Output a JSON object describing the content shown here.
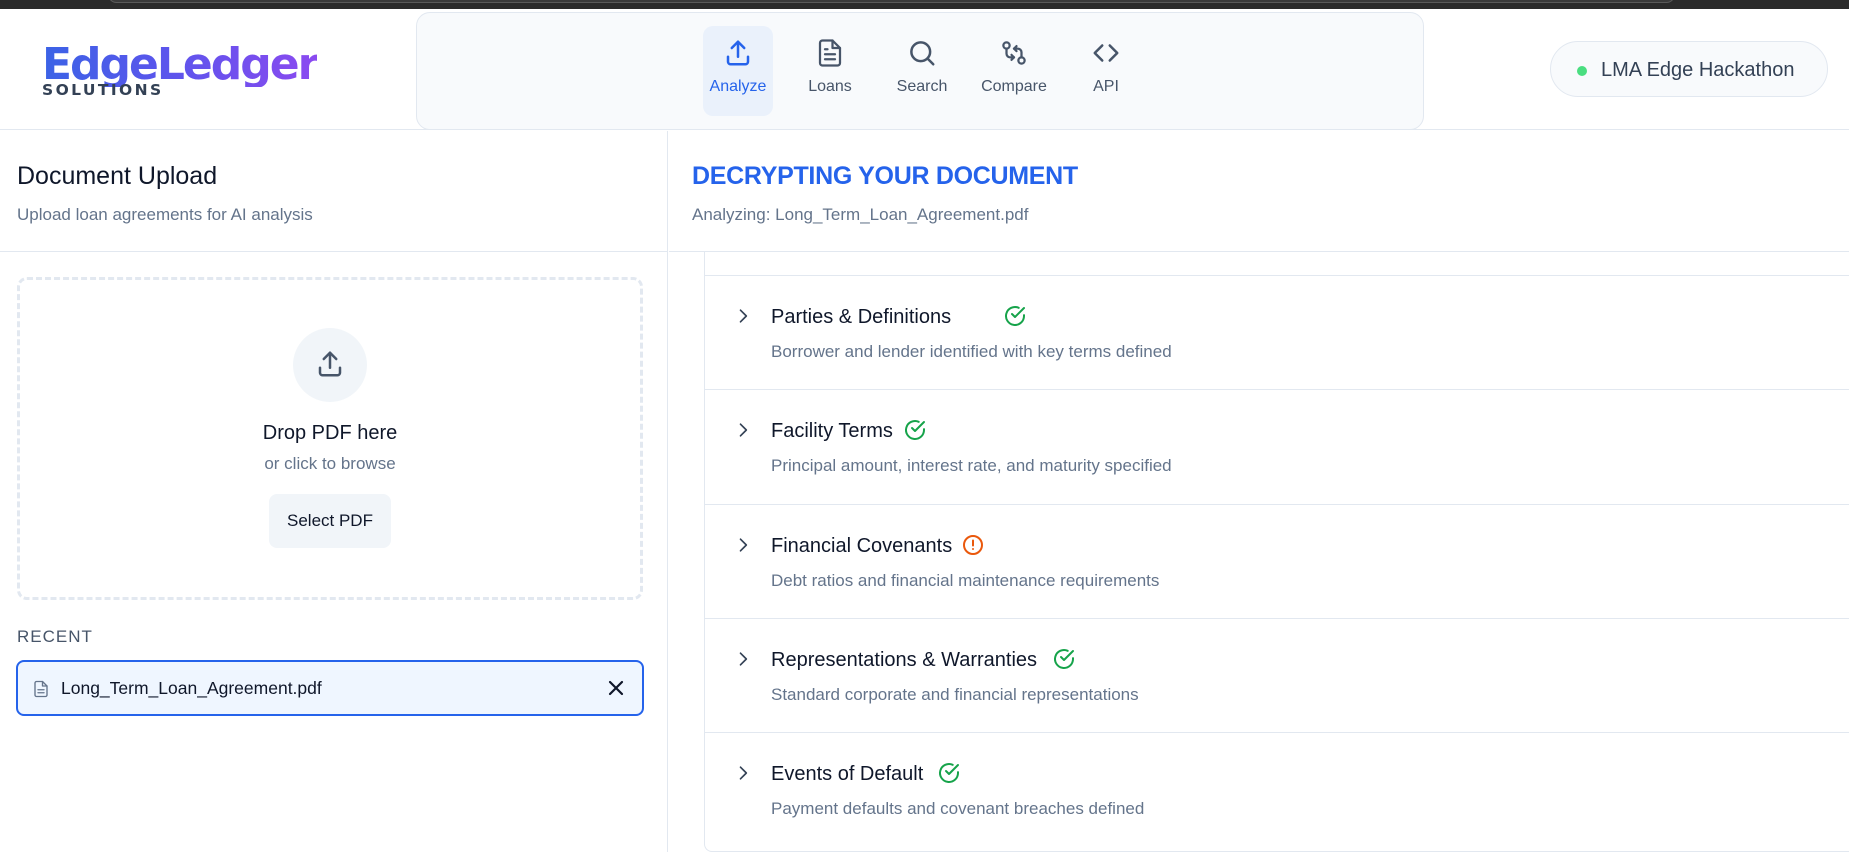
{
  "app": {
    "logo_main": "EdgeLedger",
    "logo_sub": "SOLUTIONS",
    "badge": "LMA Edge Hackathon",
    "badge_dot_color": "#4ade80"
  },
  "nav": {
    "items": [
      {
        "label": "Analyze",
        "icon": "upload-icon",
        "active": true
      },
      {
        "label": "Loans",
        "icon": "document-icon",
        "active": false
      },
      {
        "label": "Search",
        "icon": "search-icon",
        "active": false
      },
      {
        "label": "Compare",
        "icon": "git-compare-icon",
        "active": false
      },
      {
        "label": "API",
        "icon": "code-icon",
        "active": false
      }
    ]
  },
  "upload": {
    "title": "Document Upload",
    "subtitle": "Upload loan agreements for AI analysis",
    "drop_title": "Drop PDF here",
    "drop_sub": "or click to browse",
    "select_button": "Select PDF",
    "recent_label": "RECENT",
    "recent_files": [
      {
        "name": "Long_Term_Loan_Agreement.pdf",
        "selected": true
      }
    ]
  },
  "analysis": {
    "title": "DECRYPTING YOUR DOCUMENT",
    "subtitle": "Analyzing: Long_Term_Loan_Agreement.pdf",
    "sections": [
      {
        "title": "Parties & Definitions",
        "description": "Borrower and lender identified with key terms defined",
        "status": "ok"
      },
      {
        "title": "Facility Terms",
        "description": "Principal amount, interest rate, and maturity specified",
        "status": "ok"
      },
      {
        "title": "Financial Covenants",
        "description": "Debt ratios and financial maintenance requirements",
        "status": "warning"
      },
      {
        "title": "Representations & Warranties",
        "description": "Standard corporate and financial representations",
        "status": "ok"
      },
      {
        "title": "Events of Default",
        "description": "Payment defaults and covenant breaches defined",
        "status": "ok"
      }
    ]
  },
  "colors": {
    "accent": "#2563eb",
    "ok": "#16a34a",
    "warning": "#ea580c"
  }
}
